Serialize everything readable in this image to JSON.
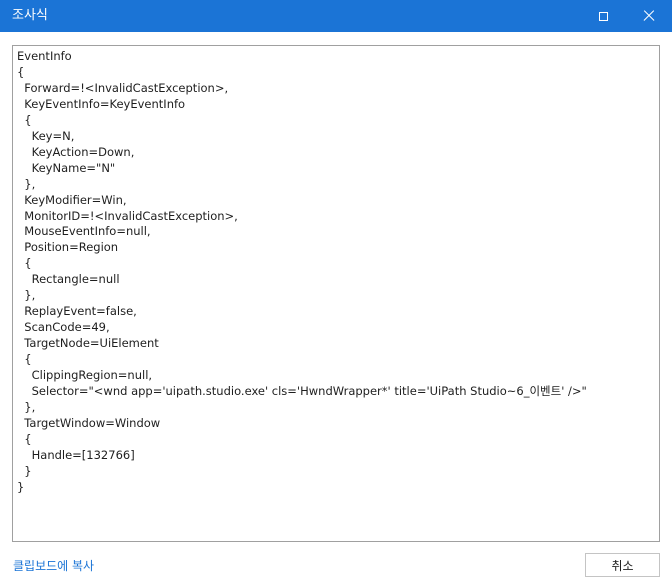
{
  "window": {
    "title": "조사식",
    "maximize_icon": "maximize-icon",
    "close_icon": "close-icon"
  },
  "content": {
    "text": "EventInfo\n{\n  Forward=!<InvalidCastException>,\n  KeyEventInfo=KeyEventInfo\n  {\n    Key=N,\n    KeyAction=Down,\n    KeyName=\"N\"\n  },\n  KeyModifier=Win,\n  MonitorID=!<InvalidCastException>,\n  MouseEventInfo=null,\n  Position=Region\n  {\n    Rectangle=null\n  },\n  ReplayEvent=false,\n  ScanCode=49,\n  TargetNode=UiElement\n  {\n    ClippingRegion=null,\n    Selector=\"<wnd app='uipath.studio.exe' cls='HwndWrapper*' title='UiPath Studio~6_이벤트' />\"\n  },\n  TargetWindow=Window\n  {\n    Handle=[132766]\n  }\n}"
  },
  "footer": {
    "copy_link": "클립보드에 복사",
    "cancel_label": "취소"
  },
  "colors": {
    "titlebar": "#1b74d6",
    "link": "#1b74d6",
    "text": "#1e1e1e",
    "border": "#a0a0a0"
  }
}
